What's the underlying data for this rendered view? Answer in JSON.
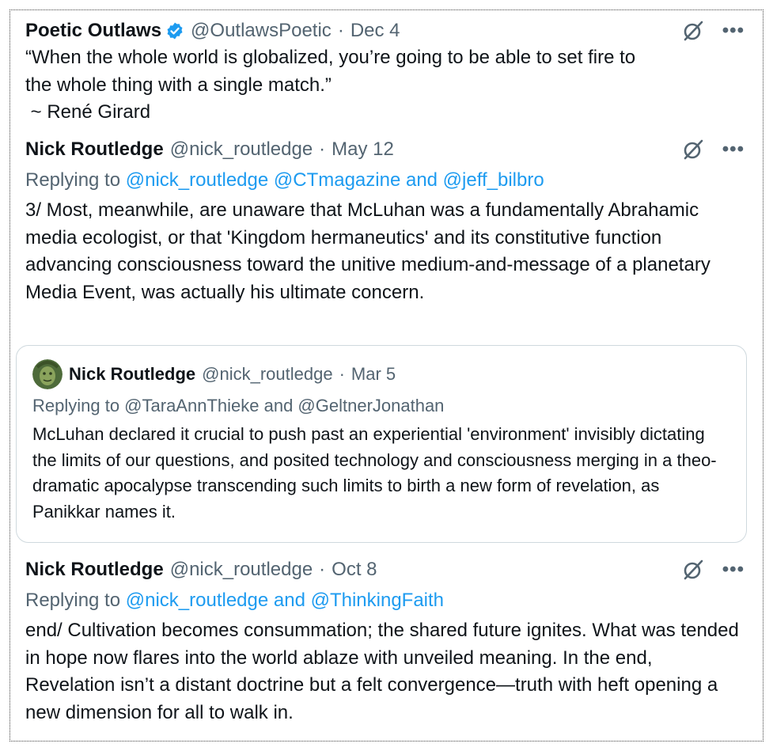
{
  "colors": {
    "link": "#1d9bf0",
    "meta": "#536471",
    "text": "#0f1419",
    "border": "#cfd9de",
    "verified": "#1d9bf0"
  },
  "tweet1": {
    "name": "Poetic Outlaws",
    "handle": "@OutlawsPoetic",
    "date": "Dec 4",
    "verified_icon": "verified-badge-icon",
    "text_line1": "“When the whole world is globalized, you’re going to be able to set fire to",
    "text_line2": "the whole thing with a single match.”",
    "text_line3": " ~ René Girard"
  },
  "tweet2": {
    "name": "Nick Routledge",
    "handle": "@nick_routledge",
    "date": "May 12",
    "reply_prefix": "Replying to",
    "reply_to": "@nick_routledge @CTmagazine and @jeff_bilbro",
    "text": "3/ Most, meanwhile, are unaware that McLuhan was a fundamentally Abrahamic media ecologist, or that 'Kingdom hermaneutics' and its constitutive function advancing consciousness toward the unitive medium-and-message of a planetary Media Event, was actually his ultimate concern."
  },
  "quote": {
    "name": "Nick Routledge",
    "handle": "@nick_routledge",
    "date": "Mar 5",
    "avatar_icon": "avatar-green-face-icon",
    "reply_text": "Replying to @TaraAnnThieke and @GeltnerJonathan",
    "text": "McLuhan declared it crucial to push past an experiential 'environment' invisibly dictating the limits of our questions, and posited technology and consciousness merging in a theo-dramatic apocalypse transcending such limits to birth a new form of revelation, as Panikkar names it."
  },
  "tweet3": {
    "name": "Nick Routledge",
    "handle": "@nick_routledge",
    "date": "Oct 8",
    "reply_prefix": "Replying to",
    "reply_to": "@nick_routledge and @ThinkingFaith",
    "text": "end/ Cultivation becomes consummation; the shared future ignites. What was tended in hope now flares into the world ablaze with unveiled meaning. In the end, Revelation isn’t a distant doctrine but a felt convergence—truth with heft opening a new dimension for all to walk in."
  },
  "ui": {
    "separator": "·",
    "more_label": "•••",
    "grok_icon": "grok-icon",
    "more_icon": "more-icon"
  }
}
